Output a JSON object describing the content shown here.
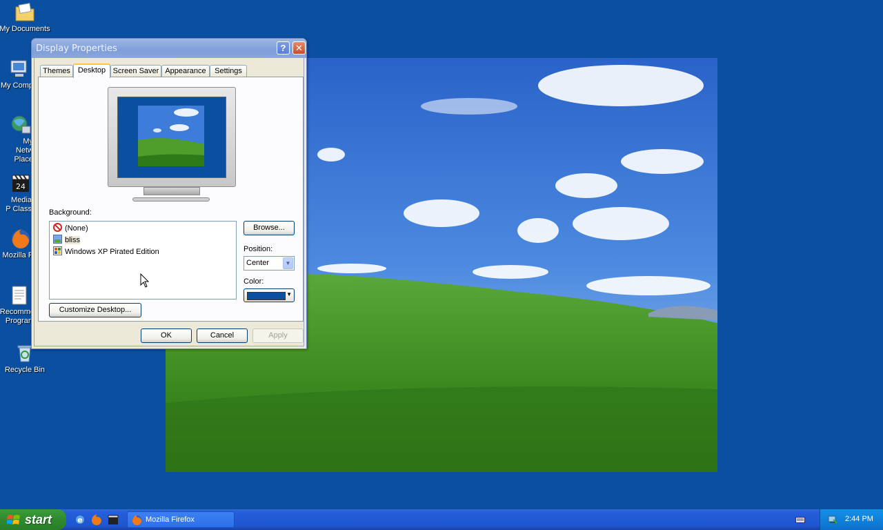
{
  "desktop": {
    "icons": [
      {
        "label": "My Documents"
      },
      {
        "label": "My Comp"
      },
      {
        "label": "My Netw Place"
      },
      {
        "label": "Media P Class"
      },
      {
        "label": "Mozilla Fi"
      },
      {
        "label": "Recomme Program"
      },
      {
        "label": "Recycle Bin"
      }
    ],
    "wallpaper_name": "bliss"
  },
  "dialog": {
    "title": "Display Properties",
    "help_label": "?",
    "close_label": "✕",
    "tabs": [
      {
        "label": "Themes"
      },
      {
        "label": "Desktop",
        "active": true
      },
      {
        "label": "Screen Saver"
      },
      {
        "label": "Appearance"
      },
      {
        "label": "Settings"
      }
    ],
    "background_label": "Background:",
    "background_items": [
      {
        "label": "(None)",
        "icon": "no-entry-icon"
      },
      {
        "label": "bliss",
        "icon": "image-file-icon",
        "selected": true
      },
      {
        "label": "Windows XP Pirated Edition",
        "icon": "html-file-icon"
      }
    ],
    "browse_label": "Browse...",
    "position_label": "Position:",
    "position_value": "Center",
    "color_label": "Color:",
    "color_value": "#0b4fa1",
    "customize_label": "Customize Desktop...",
    "ok_label": "OK",
    "cancel_label": "Cancel",
    "apply_label": "Apply"
  },
  "taskbar": {
    "start_label": "start",
    "task_label": "Mozilla Firefox",
    "clock": "2:44 PM"
  }
}
